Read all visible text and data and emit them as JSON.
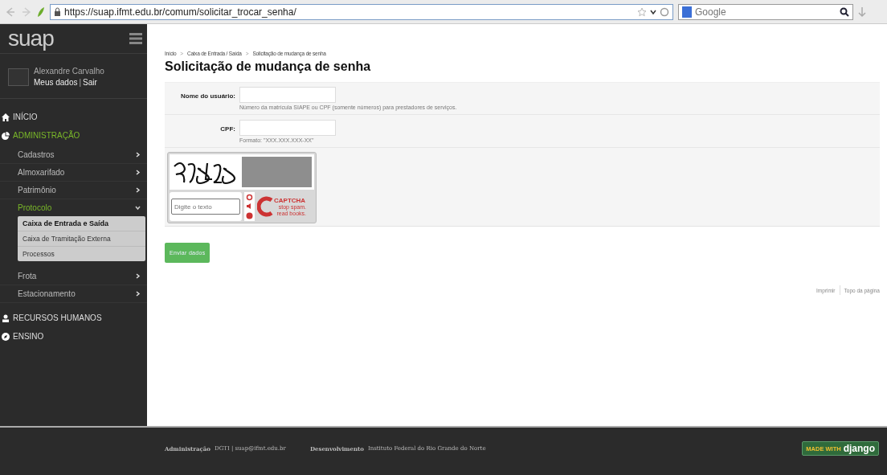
{
  "browser": {
    "url": "https://suap.ifmt.edu.br/comum/solicitar_trocar_senha/",
    "search": {
      "placeholder": "Google"
    }
  },
  "sidebar": {
    "logo": "suap",
    "user": {
      "name": "Alexandre Carvalho",
      "links": [
        "Meus dados",
        "Sair"
      ],
      "separator": "|"
    },
    "menu": [
      {
        "label": "INÍCIO",
        "selected": false,
        "expanded": false
      },
      {
        "label": "ADMINISTRAÇÃO",
        "selected": true,
        "expanded": true,
        "children": [
          {
            "label": "Cadastros",
            "selected": false,
            "expanded": false
          },
          {
            "label": "Almoxarifado",
            "selected": false,
            "expanded": false
          },
          {
            "label": "Patrimônio",
            "selected": false,
            "expanded": false
          },
          {
            "label": "Protocolo",
            "selected": true,
            "expanded": true,
            "children": [
              {
                "label": "Caixa de Entrada e Saída",
                "selected": true
              },
              {
                "label": "Caixa de Tramitação Externa",
                "selected": false
              },
              {
                "label": "Processos",
                "selected": false
              }
            ]
          },
          {
            "label": "Frota",
            "selected": false,
            "expanded": false
          },
          {
            "label": "Estacionamento",
            "selected": false,
            "expanded": false
          }
        ]
      },
      {
        "label": "RECURSOS HUMANOS",
        "selected": false,
        "expanded": false
      },
      {
        "label": "ENSINO",
        "selected": false,
        "expanded": false
      }
    ]
  },
  "breadcrumb": {
    "items": [
      "Início",
      "Caixa de Entrada / Saída",
      "Solicitação de mudança de senha"
    ],
    "separator": ">"
  },
  "title": "Solicitação de mudança de senha",
  "form": {
    "fields": [
      {
        "label": "Nome do usuário:",
        "help": "Número da matrícula SIAPE ou CPF (somente números) para prestadores de serviços."
      },
      {
        "label": "CPF:",
        "help": "Formato: \"XXX.XXX.XXX-XX\""
      }
    ],
    "captcha": {
      "placeholder": "Digite o texto",
      "brand": "CAPTCHA",
      "tagline": "stop spam. read books."
    },
    "submit": "Enviar dados"
  },
  "page_links": [
    "Imprimir",
    "Topo da página"
  ],
  "footer": [
    {
      "label": "Administração",
      "value": "DGTI | suap@ifmt.edu.br"
    },
    {
      "label": "Desenvolvimento",
      "value": "Instituto Federal do Rio Grande do Norte"
    }
  ],
  "badge": {
    "prefix": "MADE WITH",
    "name": "django"
  }
}
